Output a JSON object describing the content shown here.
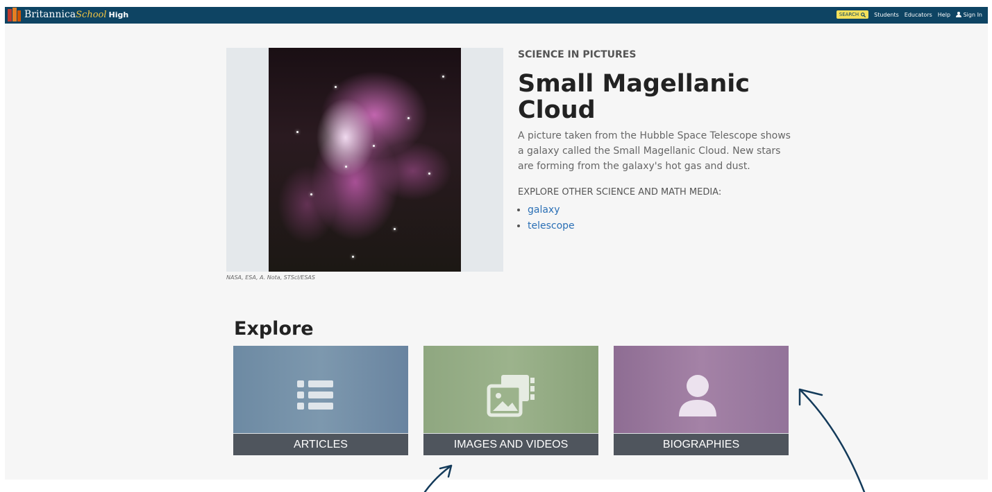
{
  "header": {
    "brand_main": "Britannica",
    "brand_school": "School",
    "brand_level": "High",
    "search_label": "SEARCH",
    "nav": [
      "Students",
      "Educators",
      "Help"
    ],
    "sign_in": "Sign In"
  },
  "media": {
    "credit": "NASA, ESA, A. Nota, STScI/ESAS",
    "kicker": "SCIENCE IN PICTURES",
    "title": "Small Magellanic Cloud",
    "description": "A picture taken from the Hubble Space Telescope shows a galaxy called the Small Magellanic Cloud. New stars are forming from the galaxy's hot gas and dust.",
    "explore_label": "EXPLORE OTHER SCIENCE AND MATH MEDIA:",
    "links": [
      "galaxy",
      "telescope"
    ]
  },
  "explore": {
    "heading": "Explore",
    "cards": [
      "ARTICLES",
      "IMAGES AND VIDEOS",
      "BIOGRAPHIES"
    ]
  },
  "colors": {
    "header_bg": "#0e4463",
    "search_bg": "#f3e05a",
    "link": "#2a6fb5",
    "card_bar": "#4f555d",
    "annotation_arrow": "#133a5a"
  },
  "icons": [
    "list-icon",
    "media-icon",
    "person-icon",
    "search-icon",
    "user-icon"
  ]
}
